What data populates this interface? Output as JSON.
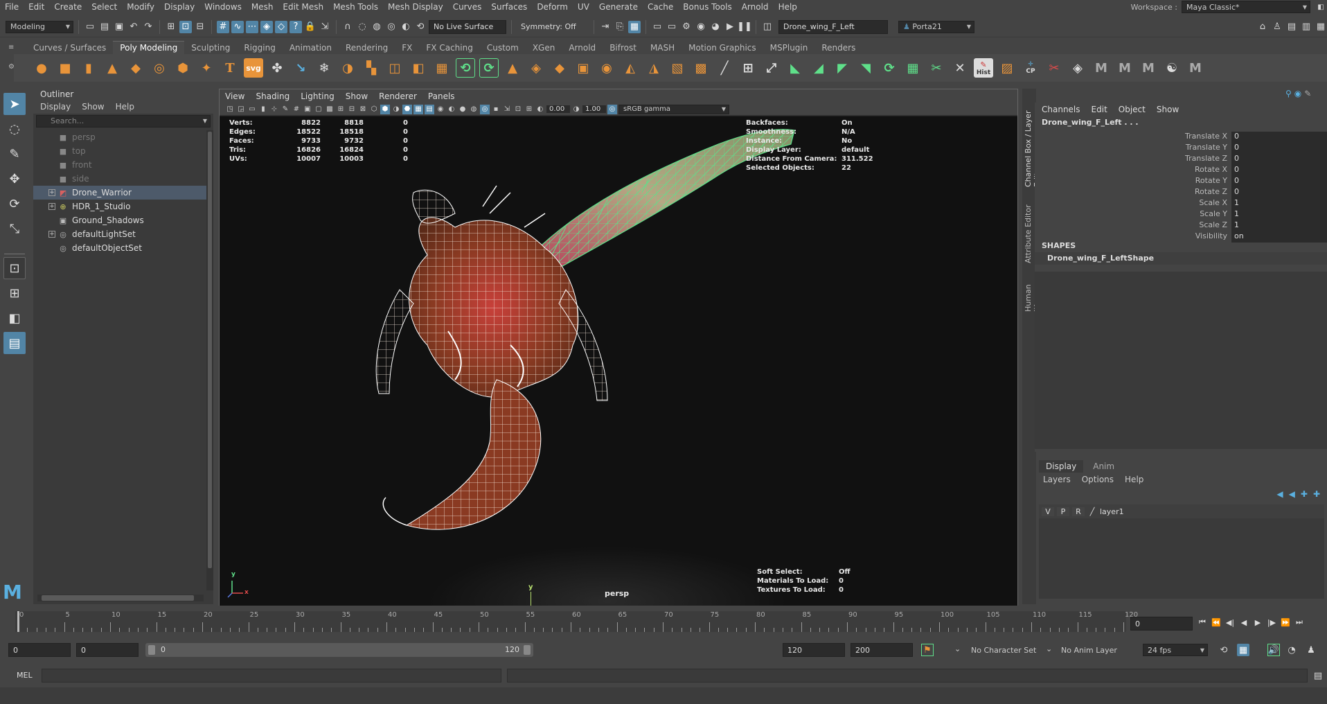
{
  "menubar": {
    "items": [
      "File",
      "Edit",
      "Create",
      "Select",
      "Modify",
      "Display",
      "Windows",
      "Mesh",
      "Edit Mesh",
      "Mesh Tools",
      "Mesh Display",
      "Curves",
      "Surfaces",
      "Deform",
      "UV",
      "Generate",
      "Cache",
      "Bonus Tools",
      "Arnold",
      "Help"
    ],
    "workspace_label": "Workspace :",
    "workspace_value": "Maya Classic*"
  },
  "statusline": {
    "mode": "Modeling",
    "live_surface": "No Live Surface",
    "symmetry": "Symmetry: Off",
    "object_name": "Drone_wing_F_Left",
    "user": "Porta21"
  },
  "shelf": {
    "tabs": [
      "Curves / Surfaces",
      "Poly Modeling",
      "Sculpting",
      "Rigging",
      "Animation",
      "Rendering",
      "FX",
      "FX Caching",
      "Custom",
      "XGen",
      "Arnold",
      "Bifrost",
      "MASH",
      "Motion Graphics",
      "MSPlugin",
      "Renders"
    ],
    "active_tab": "Poly Modeling",
    "hist_label": "Hist",
    "cp_label": "CP",
    "text_tool": "T",
    "svg_tool": "svg"
  },
  "outliner": {
    "title": "Outliner",
    "menu": [
      "Display",
      "Show",
      "Help"
    ],
    "search_placeholder": "Search...",
    "items": [
      {
        "label": "persp",
        "icon": "camera-icon"
      },
      {
        "label": "top",
        "icon": "camera-icon"
      },
      {
        "label": "front",
        "icon": "camera-icon"
      },
      {
        "label": "side",
        "icon": "camera-icon"
      },
      {
        "label": "Drone_Warrior",
        "icon": "mesh-icon"
      },
      {
        "label": "HDR_1_Studio",
        "icon": "sphere-icon"
      },
      {
        "label": "Ground_Shadows",
        "icon": "group-icon"
      },
      {
        "label": "defaultLightSet",
        "icon": "set-icon"
      },
      {
        "label": "defaultObjectSet",
        "icon": "set-icon"
      }
    ]
  },
  "viewport": {
    "menu": [
      "View",
      "Shading",
      "Lighting",
      "Show",
      "Renderer",
      "Panels"
    ],
    "exposure": "0.00",
    "gamma": "1.00",
    "color_space": "sRGB gamma",
    "camera_label": "persp",
    "axis_y": "y",
    "axis_x": "x",
    "stats": [
      {
        "label": "Verts:",
        "a": "8822",
        "b": "8818",
        "c": "0"
      },
      {
        "label": "Edges:",
        "a": "18522",
        "b": "18518",
        "c": "0"
      },
      {
        "label": "Faces:",
        "a": "9733",
        "b": "9732",
        "c": "0"
      },
      {
        "label": "Tris:",
        "a": "16826",
        "b": "16824",
        "c": "0"
      },
      {
        "label": "UVs:",
        "a": "10007",
        "b": "10003",
        "c": "0"
      }
    ],
    "info": [
      {
        "label": "Backfaces:",
        "value": "On"
      },
      {
        "label": "Smoothness:",
        "value": "N/A"
      },
      {
        "label": "Instance:",
        "value": "No"
      },
      {
        "label": "Display Layer:",
        "value": "default"
      },
      {
        "label": "Distance From Camera:",
        "value": "311.522"
      },
      {
        "label": "Selected Objects:",
        "value": "22"
      }
    ],
    "bottom_info": [
      {
        "label": "Soft Select:",
        "value": "Off"
      },
      {
        "label": "Materials To Load:",
        "value": "0"
      },
      {
        "label": "Textures To Load:",
        "value": "0"
      }
    ]
  },
  "side_tabs": [
    "Channel Box / Layer Editor",
    "Attribute Editor",
    "Human IK"
  ],
  "channelbox": {
    "menu": [
      "Channels",
      "Edit",
      "Object",
      "Show"
    ],
    "object": "Drone_wing_F_Left . . .",
    "attrs": [
      {
        "name": "Translate X",
        "value": "0"
      },
      {
        "name": "Translate Y",
        "value": "0"
      },
      {
        "name": "Translate Z",
        "value": "0"
      },
      {
        "name": "Rotate X",
        "value": "0"
      },
      {
        "name": "Rotate Y",
        "value": "0"
      },
      {
        "name": "Rotate Z",
        "value": "0"
      },
      {
        "name": "Scale X",
        "value": "1"
      },
      {
        "name": "Scale Y",
        "value": "1"
      },
      {
        "name": "Scale Z",
        "value": "1"
      },
      {
        "name": "Visibility",
        "value": "on"
      }
    ],
    "shapes_title": "SHAPES",
    "shape_name": "Drone_wing_F_LeftShape"
  },
  "layers": {
    "tabs": [
      "Display",
      "Anim"
    ],
    "active_tab": "Display",
    "menu": [
      "Layers",
      "Options",
      "Help"
    ],
    "row": {
      "v": "V",
      "p": "P",
      "r": "R",
      "name": "layer1"
    }
  },
  "timeline": {
    "ticks": [
      "0",
      "5",
      "10",
      "15",
      "20",
      "25",
      "30",
      "35",
      "40",
      "45",
      "50",
      "55",
      "60",
      "65",
      "70",
      "75",
      "80",
      "85",
      "90",
      "95",
      "100",
      "105",
      "110",
      "115",
      "120"
    ],
    "current_frame": "0"
  },
  "range": {
    "start": "0",
    "inner_start": "0",
    "slider_start": "0",
    "slider_end": "120",
    "end": "120",
    "outer_end": "200",
    "character_set": "No Character Set",
    "anim_layer": "No Anim Layer",
    "fps": "24 fps"
  },
  "cmdline": {
    "label": "MEL"
  },
  "colors": {
    "accent": "#5285a6",
    "wireframe": "#ffffff",
    "selected_wire": "#5fe08a"
  }
}
